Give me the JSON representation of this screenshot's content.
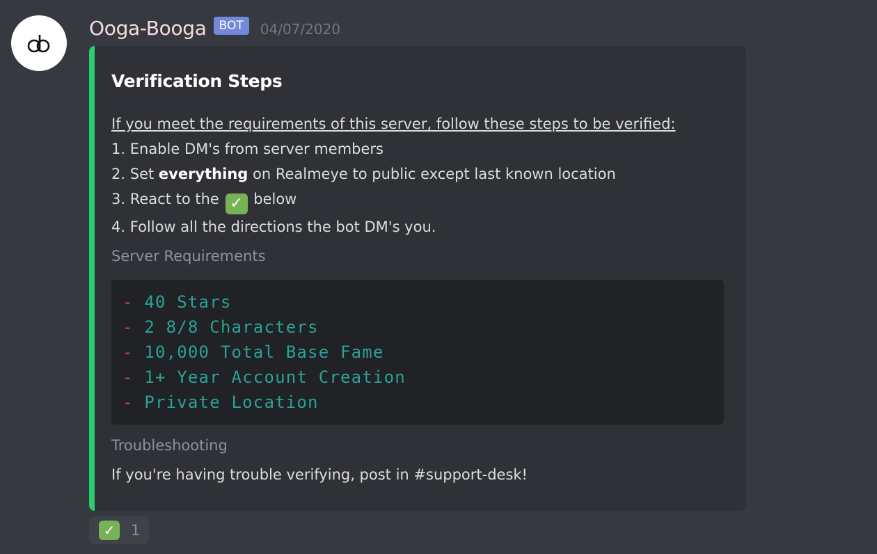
{
  "message": {
    "username": "Ooga-Booga",
    "bot_tag": "BOT",
    "timestamp": "04/07/2020",
    "avatar_icon": "ob-logo-icon"
  },
  "embed": {
    "accent_color": "#2ecc71",
    "title": "Verification Steps",
    "intro": "If you meet the requirements of this server, follow these steps to be verified:",
    "steps": [
      {
        "num": "1.",
        "text": "Enable DM's from server members"
      },
      {
        "num": "2.",
        "pre": "Set",
        "bold": "everything",
        "post": "on Realmeye to public except last known location"
      },
      {
        "num": "3.",
        "pre": "React to the",
        "post": "below"
      },
      {
        "num": "4.",
        "text": "Follow all the directions the bot DM's you."
      }
    ],
    "fields": [
      {
        "name": "Server Requirements",
        "code_lines": [
          "40 Stars",
          "2 8/8 Characters",
          "10,000 Total Base Fame",
          "1+ Year Account Creation",
          "Private Location"
        ],
        "bullet": "-"
      },
      {
        "name": "Troubleshooting",
        "value": "If you're having trouble verifying, post in #support-desk!"
      }
    ]
  },
  "reaction": {
    "emoji": "✓",
    "emoji_name": "white-check-mark-icon",
    "count": "1"
  }
}
